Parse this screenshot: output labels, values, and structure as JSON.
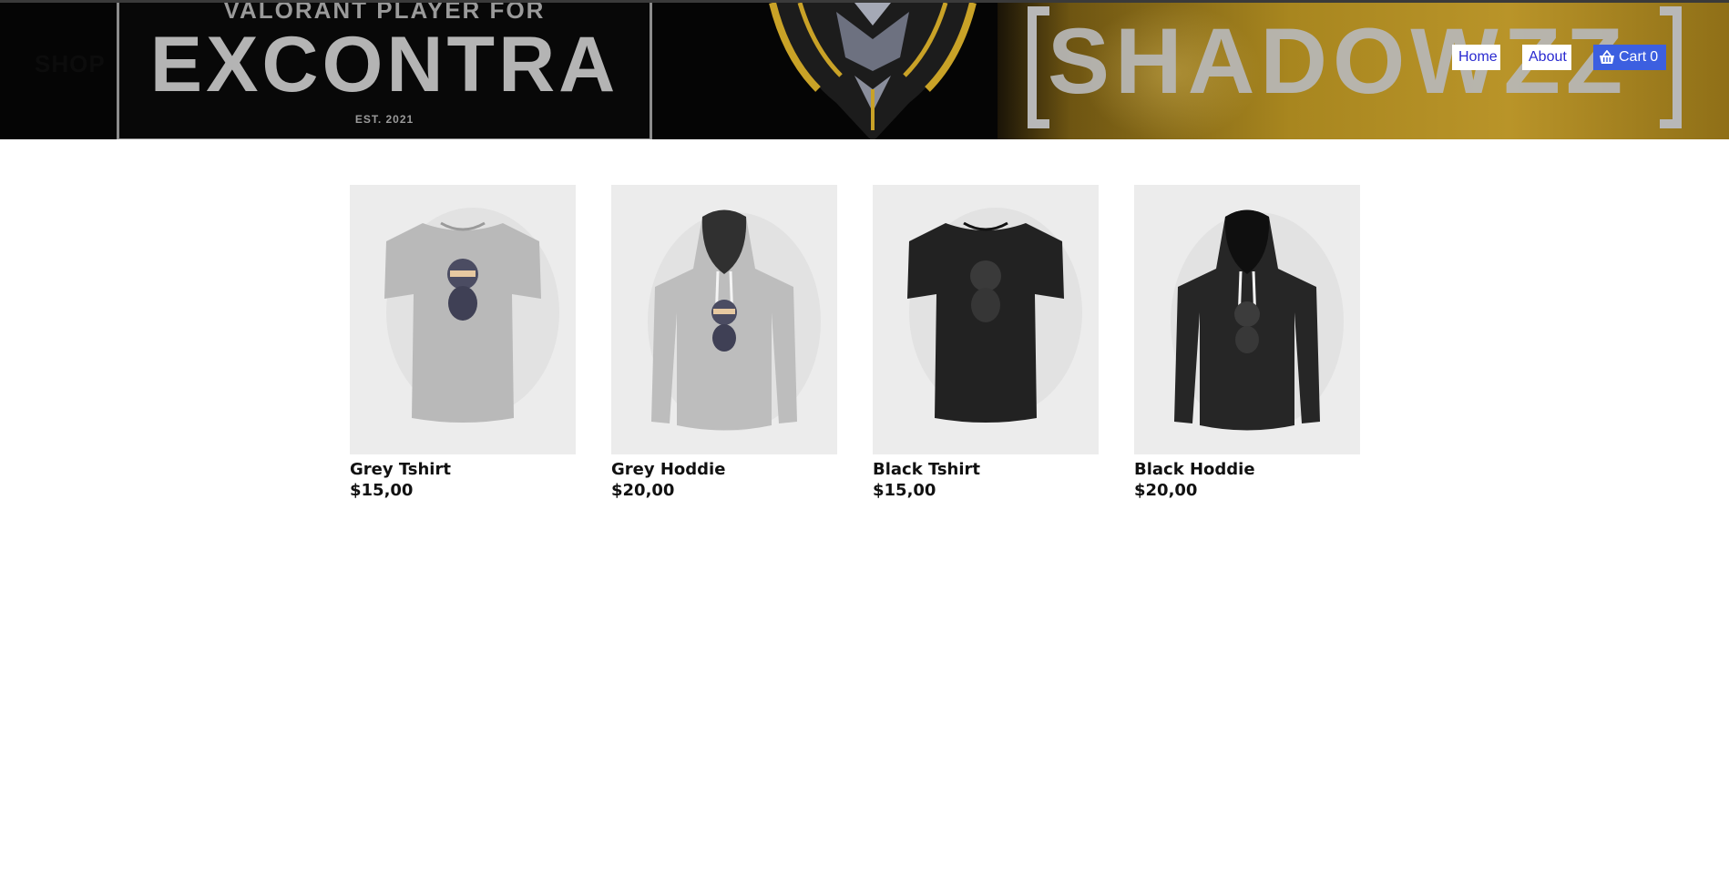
{
  "header": {
    "site_name": "SHOP",
    "banner": {
      "logo_top_text": "VALORANT PLAYER FOR",
      "logo_main_text": "EXCONTRA",
      "logo_est_text": "EST. 2021",
      "brand_word": "SHADOWZZ"
    },
    "nav": {
      "home_label": "Home",
      "about_label": "About",
      "cart_label": "Cart",
      "cart_count": "0"
    }
  },
  "products": [
    {
      "name": "Grey Tshirt",
      "price": "$15,00",
      "garment": "tshirt",
      "color": "grey"
    },
    {
      "name": "Grey Hoddie",
      "price": "$20,00",
      "garment": "hoodie",
      "color": "grey"
    },
    {
      "name": "Black Tshirt",
      "price": "$15,00",
      "garment": "tshirt",
      "color": "black"
    },
    {
      "name": "Black Hoddie",
      "price": "$20,00",
      "garment": "hoodie",
      "color": "black"
    }
  ],
  "colors": {
    "nav_link_text": "#2a2ad0",
    "cart_button_bg": "#3c5fe0",
    "product_bg": "#ececec",
    "banner_gold": "#b99429"
  }
}
